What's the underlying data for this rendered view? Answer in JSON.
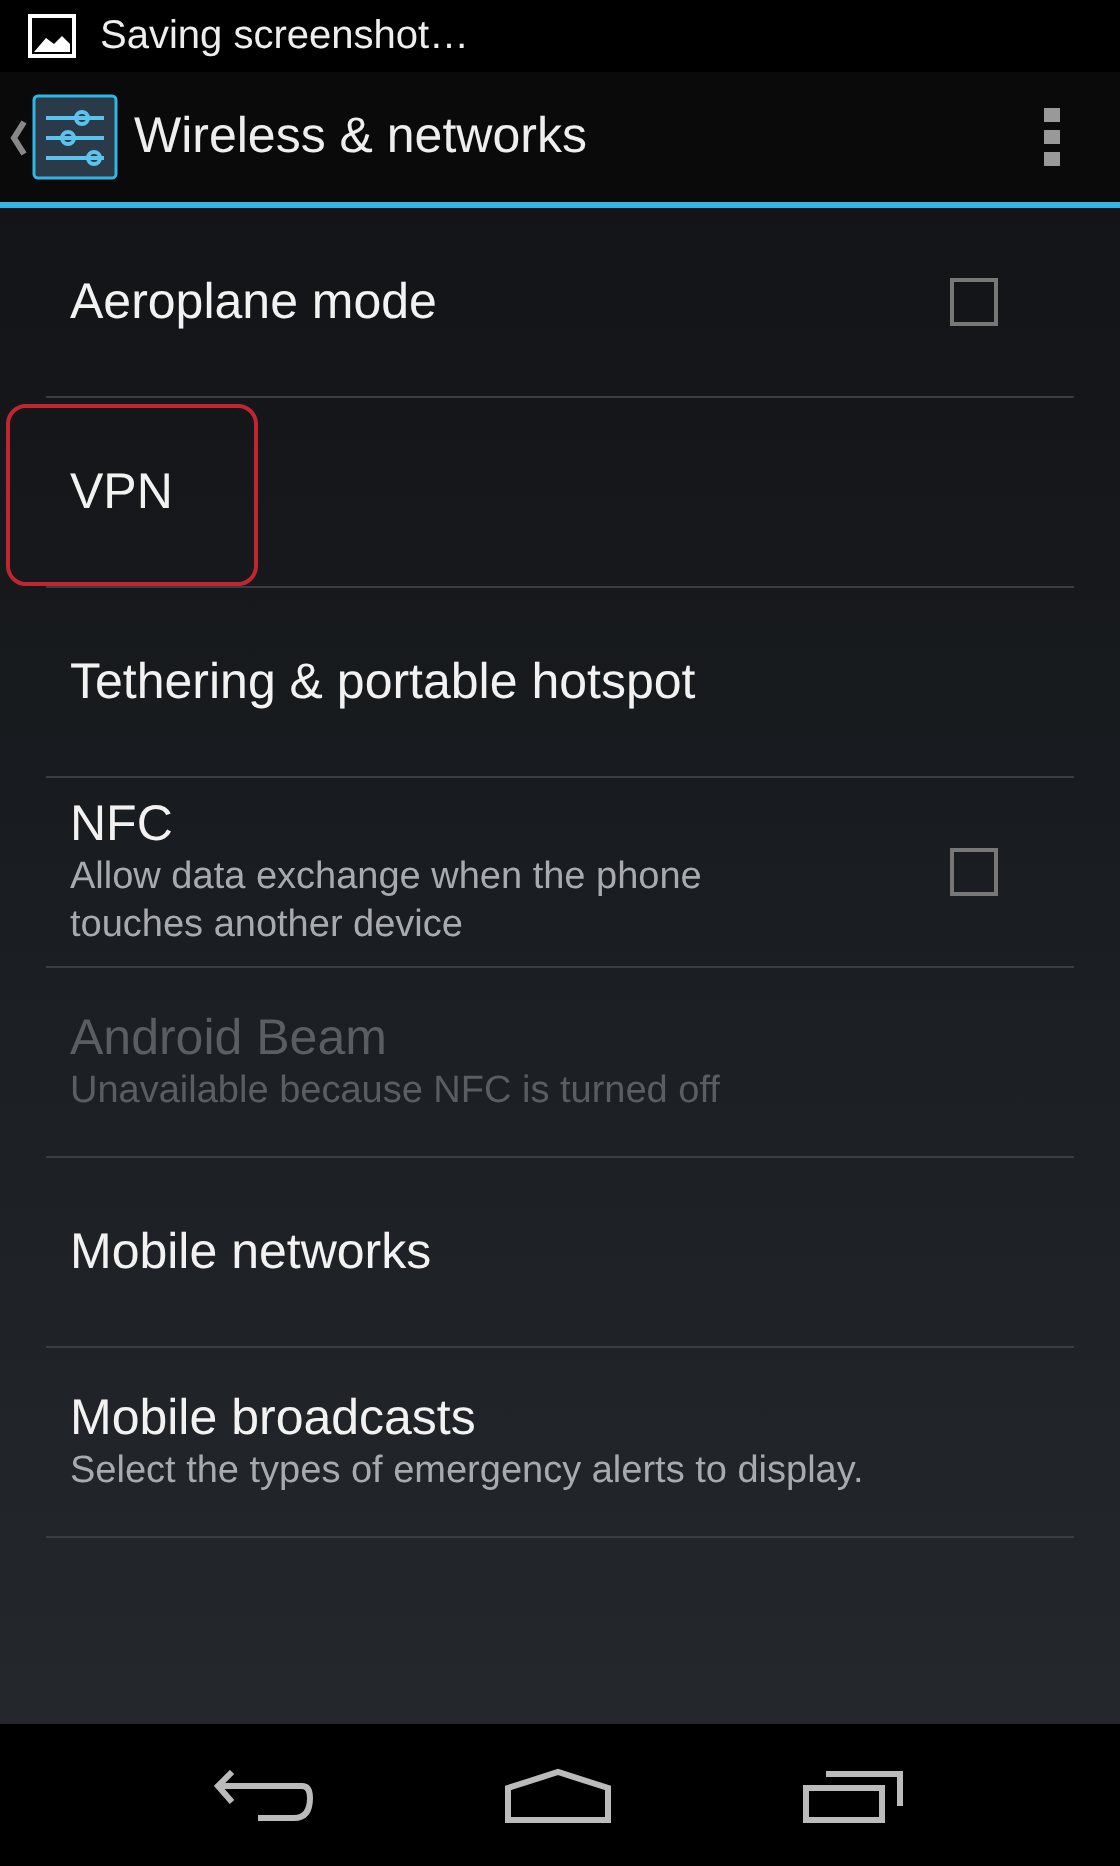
{
  "status_bar": {
    "notification": "Saving screenshot…"
  },
  "action_bar": {
    "title": "Wireless & networks"
  },
  "items": [
    {
      "kind": "checkbox",
      "title": "Aeroplane mode",
      "checked": false,
      "disabled": false,
      "highlighted": false
    },
    {
      "kind": "plain",
      "title": "VPN",
      "disabled": false,
      "highlighted": true
    },
    {
      "kind": "plain",
      "title": "Tethering & portable hotspot",
      "disabled": false,
      "highlighted": false
    },
    {
      "kind": "checkbox",
      "title": "NFC",
      "summary": "Allow data exchange when the phone touches another device",
      "checked": false,
      "disabled": false,
      "highlighted": false
    },
    {
      "kind": "plain",
      "title": "Android Beam",
      "summary": "Unavailable because NFC is turned off",
      "disabled": true,
      "highlighted": false
    },
    {
      "kind": "plain",
      "title": "Mobile networks",
      "disabled": false,
      "highlighted": false
    },
    {
      "kind": "plain",
      "title": "Mobile broadcasts",
      "summary": "Select the types of emergency alerts to display.",
      "disabled": false,
      "highlighted": false
    }
  ]
}
